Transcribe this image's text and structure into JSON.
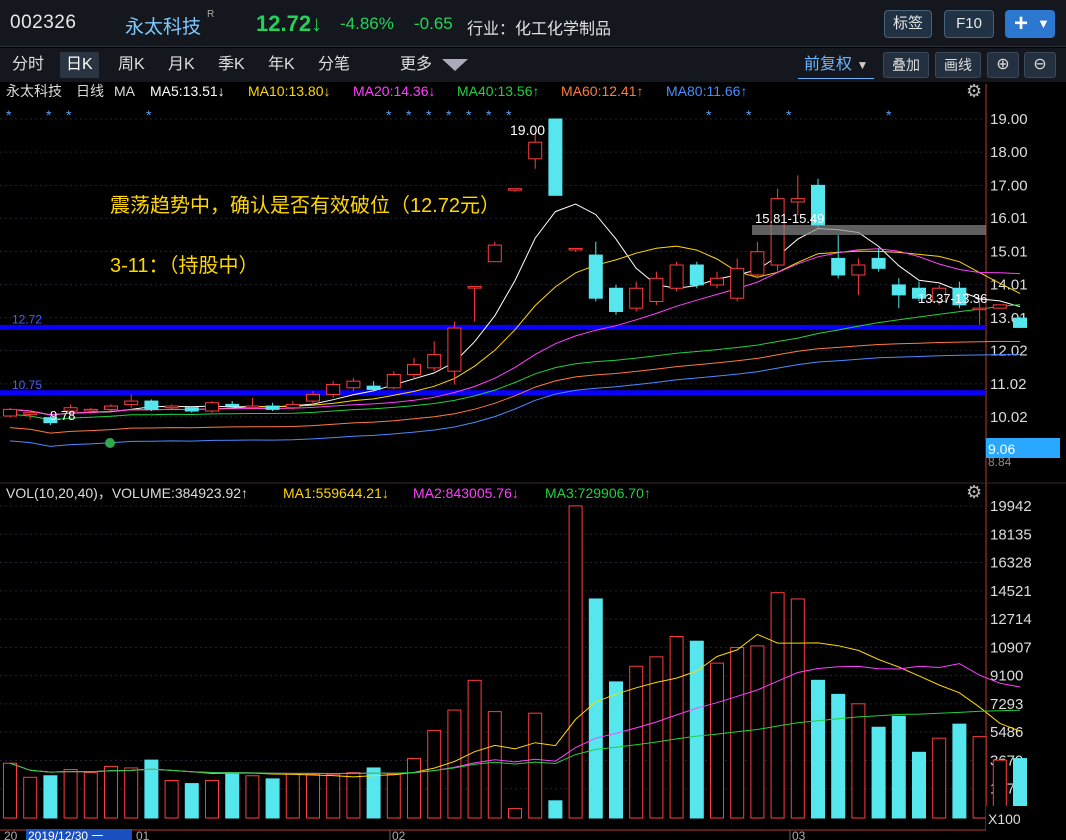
{
  "header": {
    "stock_code": "002326",
    "stock_name": "永太科技",
    "name_sup": "R",
    "price": "12.72",
    "arrow": "↓",
    "change_pct": "-4.86%",
    "change_abs": "-0.65",
    "industry": "行业：化工化学制品",
    "buttons": {
      "bookmark": "标签",
      "f10": "F10"
    }
  },
  "tabs": [
    "分时",
    "日K",
    "周K",
    "月K",
    "季K",
    "年K",
    "分笔"
  ],
  "active_tab": "日K",
  "more_label": "更多",
  "toolbar": {
    "adjust_label": "前复权",
    "overlay_label": "叠加",
    "draw_label": "画线"
  },
  "price_panel": {
    "name": "永太科技",
    "period": "日线",
    "indicator": "MA",
    "ma_values": [
      {
        "text": "MA5:13.51↓",
        "color": "#ffffff"
      },
      {
        "text": "MA10:13.80↓",
        "color": "#ffd700"
      },
      {
        "text": "MA20:14.36↓",
        "color": "#ff40ff"
      },
      {
        "text": "MA40:13.56↑",
        "color": "#22d040"
      },
      {
        "text": "MA60:12.41↑",
        "color": "#ff7a3c"
      },
      {
        "text": "MA80:11.66↑",
        "color": "#4a8cff"
      }
    ],
    "y_ticks": [
      "19.00",
      "18.00",
      "17.00",
      "16.01",
      "15.01",
      "14.01",
      "13.01",
      "12.02",
      "11.02",
      "10.02"
    ],
    "y_range": [
      9.0,
      19.7
    ],
    "current_tag": "9.06",
    "current_tag_partial": "8.84",
    "annotation_line1": "震荡趋势中，确认是否有效破位（12.72元）",
    "annotation_line2": "3-11：（持股中）",
    "hline_1_label": "12.72",
    "hline_1_value": 12.72,
    "hline_2_label": "10.75",
    "hline_2_value": 10.75,
    "gap_label": "15.81-15.49",
    "gap_label2": "13.37-13.36",
    "high_label": "19.00",
    "low_label": "9.78",
    "colors": {
      "up": "#ff3c3c",
      "down": "#55e6ee",
      "hline": "#0a00ff",
      "axis": "#c0392b"
    }
  },
  "volume_panel": {
    "header": "VOL(10,20,40)，VOLUME:384923.92↑",
    "mas": [
      {
        "text": "MA1:559644.21↓",
        "color": "#ffd700"
      },
      {
        "text": "MA2:843005.76↓",
        "color": "#ff40ff"
      },
      {
        "text": "MA3:729906.70↑",
        "color": "#22d040"
      }
    ],
    "y_ticks": [
      "19942",
      "18135",
      "16328",
      "14521",
      "12714",
      "10907",
      "9100",
      "7293",
      "5486",
      "3679",
      "1872"
    ],
    "unit": "X100"
  },
  "x_axis": {
    "date_box": "2019/12/30 一",
    "labels": [
      "20",
      "01",
      "02",
      "03"
    ]
  },
  "chart_data": {
    "type": "candlestick",
    "categories_note": "daily bars, ~48 sessions",
    "candles": [
      {
        "o": 10.05,
        "c": 10.25,
        "h": 10.3,
        "l": 10.0,
        "v": 3500
      },
      {
        "o": 10.1,
        "c": 10.15,
        "h": 10.2,
        "l": 9.95,
        "v": 2600
      },
      {
        "o": 10.0,
        "c": 9.85,
        "h": 10.05,
        "l": 9.78,
        "v": 2700
      },
      {
        "o": 10.2,
        "c": 10.3,
        "h": 10.4,
        "l": 10.15,
        "v": 3100
      },
      {
        "o": 10.2,
        "c": 10.25,
        "h": 10.3,
        "l": 10.1,
        "v": 2900
      },
      {
        "o": 10.25,
        "c": 10.35,
        "h": 10.4,
        "l": 10.2,
        "v": 3300
      },
      {
        "o": 10.4,
        "c": 10.5,
        "h": 10.7,
        "l": 10.3,
        "v": 3200
      },
      {
        "o": 10.5,
        "c": 10.25,
        "h": 10.55,
        "l": 10.2,
        "v": 3700
      },
      {
        "o": 10.3,
        "c": 10.35,
        "h": 10.4,
        "l": 10.25,
        "v": 2400
      },
      {
        "o": 10.3,
        "c": 10.2,
        "h": 10.35,
        "l": 10.15,
        "v": 2200
      },
      {
        "o": 10.2,
        "c": 10.45,
        "h": 10.5,
        "l": 10.15,
        "v": 2400
      },
      {
        "o": 10.4,
        "c": 10.35,
        "h": 10.5,
        "l": 10.3,
        "v": 2800
      },
      {
        "o": 10.3,
        "c": 10.35,
        "h": 10.6,
        "l": 10.25,
        "v": 2700
      },
      {
        "o": 10.35,
        "c": 10.25,
        "h": 10.45,
        "l": 10.2,
        "v": 2500
      },
      {
        "o": 10.3,
        "c": 10.4,
        "h": 10.5,
        "l": 10.25,
        "v": 2800
      },
      {
        "o": 10.5,
        "c": 10.7,
        "h": 10.8,
        "l": 10.4,
        "v": 2800
      },
      {
        "o": 10.7,
        "c": 11.0,
        "h": 11.1,
        "l": 10.6,
        "v": 2800
      },
      {
        "o": 10.9,
        "c": 11.1,
        "h": 11.2,
        "l": 10.8,
        "v": 2900
      },
      {
        "o": 10.95,
        "c": 10.85,
        "h": 11.1,
        "l": 10.8,
        "v": 3200
      },
      {
        "o": 10.9,
        "c": 11.3,
        "h": 11.4,
        "l": 10.85,
        "v": 2800
      },
      {
        "o": 11.3,
        "c": 11.6,
        "h": 11.8,
        "l": 11.2,
        "v": 3800
      },
      {
        "o": 11.5,
        "c": 11.9,
        "h": 12.3,
        "l": 11.4,
        "v": 5600
      },
      {
        "o": 11.4,
        "c": 12.7,
        "h": 12.9,
        "l": 11.0,
        "v": 6900
      },
      {
        "o": 13.95,
        "c": 13.95,
        "h": 13.95,
        "l": 12.9,
        "v": 8800
      },
      {
        "o": 14.7,
        "c": 15.2,
        "h": 15.3,
        "l": 14.7,
        "v": 6800
      },
      {
        "o": 16.9,
        "c": 16.9,
        "h": 16.9,
        "l": 16.8,
        "v": 600
      },
      {
        "o": 17.8,
        "c": 18.3,
        "h": 18.6,
        "l": 17.5,
        "v": 6700
      },
      {
        "o": 19.0,
        "c": 16.7,
        "h": 19.0,
        "l": 16.7,
        "v": 1100
      },
      {
        "o": 15.1,
        "c": 15.1,
        "h": 15.1,
        "l": 15.0,
        "v": 19950
      },
      {
        "o": 14.9,
        "c": 13.6,
        "h": 15.3,
        "l": 13.5,
        "v": 14000
      },
      {
        "o": 13.9,
        "c": 13.2,
        "h": 14.0,
        "l": 13.1,
        "v": 8700
      },
      {
        "o": 13.3,
        "c": 13.9,
        "h": 14.1,
        "l": 13.2,
        "v": 9700
      },
      {
        "o": 13.5,
        "c": 14.2,
        "h": 14.4,
        "l": 13.4,
        "v": 10300
      },
      {
        "o": 13.9,
        "c": 14.6,
        "h": 14.7,
        "l": 13.8,
        "v": 11600
      },
      {
        "o": 14.6,
        "c": 14.0,
        "h": 14.7,
        "l": 13.9,
        "v": 11300
      },
      {
        "o": 14.0,
        "c": 14.2,
        "h": 14.4,
        "l": 13.9,
        "v": 9900
      },
      {
        "o": 13.6,
        "c": 14.5,
        "h": 14.8,
        "l": 13.5,
        "v": 10900
      },
      {
        "o": 14.3,
        "c": 15.0,
        "h": 15.3,
        "l": 14.2,
        "v": 11000
      },
      {
        "o": 14.6,
        "c": 16.6,
        "h": 16.9,
        "l": 14.4,
        "v": 14400
      },
      {
        "o": 16.5,
        "c": 16.6,
        "h": 17.3,
        "l": 16.1,
        "v": 14000
      },
      {
        "o": 17.0,
        "c": 15.8,
        "h": 17.2,
        "l": 15.7,
        "v": 8800
      },
      {
        "o": 14.8,
        "c": 14.3,
        "h": 15.5,
        "l": 14.2,
        "v": 7900
      },
      {
        "o": 14.3,
        "c": 14.6,
        "h": 14.8,
        "l": 13.7,
        "v": 7300
      },
      {
        "o": 14.8,
        "c": 14.5,
        "h": 15.1,
        "l": 14.4,
        "v": 5800
      },
      {
        "o": 14.0,
        "c": 13.7,
        "h": 14.2,
        "l": 13.3,
        "v": 6500
      },
      {
        "o": 13.9,
        "c": 13.6,
        "h": 14.1,
        "l": 13.5,
        "v": 4200
      },
      {
        "o": 13.5,
        "c": 13.9,
        "h": 14.0,
        "l": 13.4,
        "v": 5100
      },
      {
        "o": 13.9,
        "c": 13.4,
        "h": 14.1,
        "l": 13.3,
        "v": 6000
      },
      {
        "o": 13.3,
        "c": 13.3,
        "h": 13.5,
        "l": 12.8,
        "v": 5200
      },
      {
        "o": 13.3,
        "c": 13.4,
        "h": 13.4,
        "l": 13.3,
        "v": 3700
      },
      {
        "o": 13.0,
        "c": 12.72,
        "h": 13.05,
        "l": 12.7,
        "v": 3800
      }
    ]
  }
}
